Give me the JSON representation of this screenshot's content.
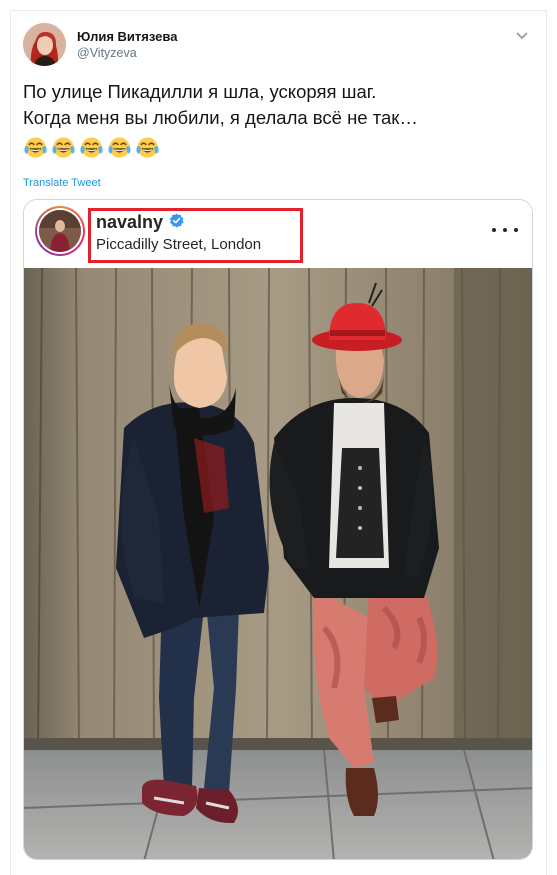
{
  "author": {
    "name": "Юлия Витязева",
    "handle": "@Vityzeva"
  },
  "tweet": {
    "lines": [
      "По улице Пикадилли я шла, ускоряя шаг.",
      "Когда меня вы любили, я делала всё не так…"
    ],
    "emoji_count": 5,
    "emoji_name": "face-with-tears-of-joy"
  },
  "translate_label": "Translate Tweet",
  "embedded_post": {
    "username": "navalny",
    "verified": true,
    "location": "Piccadilly Street, London"
  },
  "colors": {
    "highlight": "#e2212b",
    "link": "#1b95e0",
    "verified": "#3897f0"
  }
}
